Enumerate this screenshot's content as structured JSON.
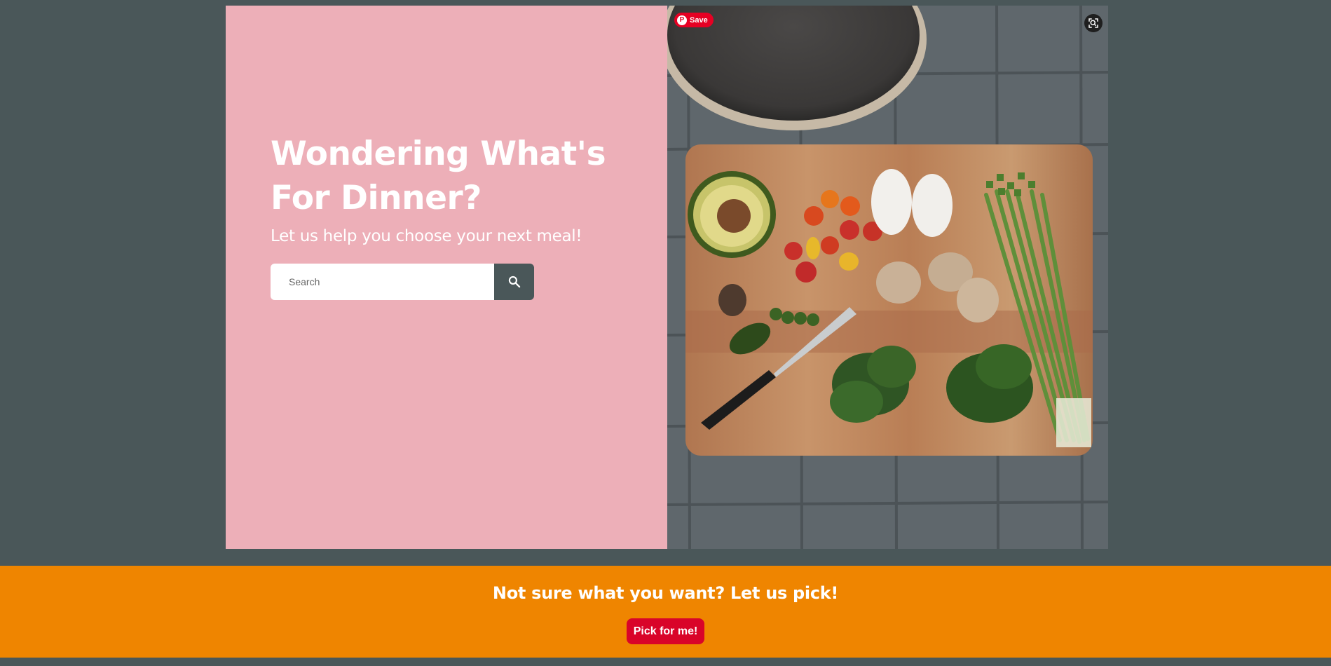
{
  "hero": {
    "title": "Wondering What's For Dinner?",
    "subtitle": "Let us help you choose your next meal!",
    "search": {
      "placeholder": "Search",
      "button_icon": "search-icon"
    },
    "image": {
      "description_icon": "food-photo",
      "pinterest_save_label": "Save",
      "visual_search_icon": "lens-icon"
    }
  },
  "banner": {
    "title": "Not sure what you want? Let us pick!",
    "button_label": "Pick for me!"
  },
  "colors": {
    "page_background": "#4a5759",
    "hero_left_background": "#edafb8",
    "banner_background": "#ef8500",
    "pick_button": "#d90429",
    "pinterest_red": "#e60023"
  }
}
